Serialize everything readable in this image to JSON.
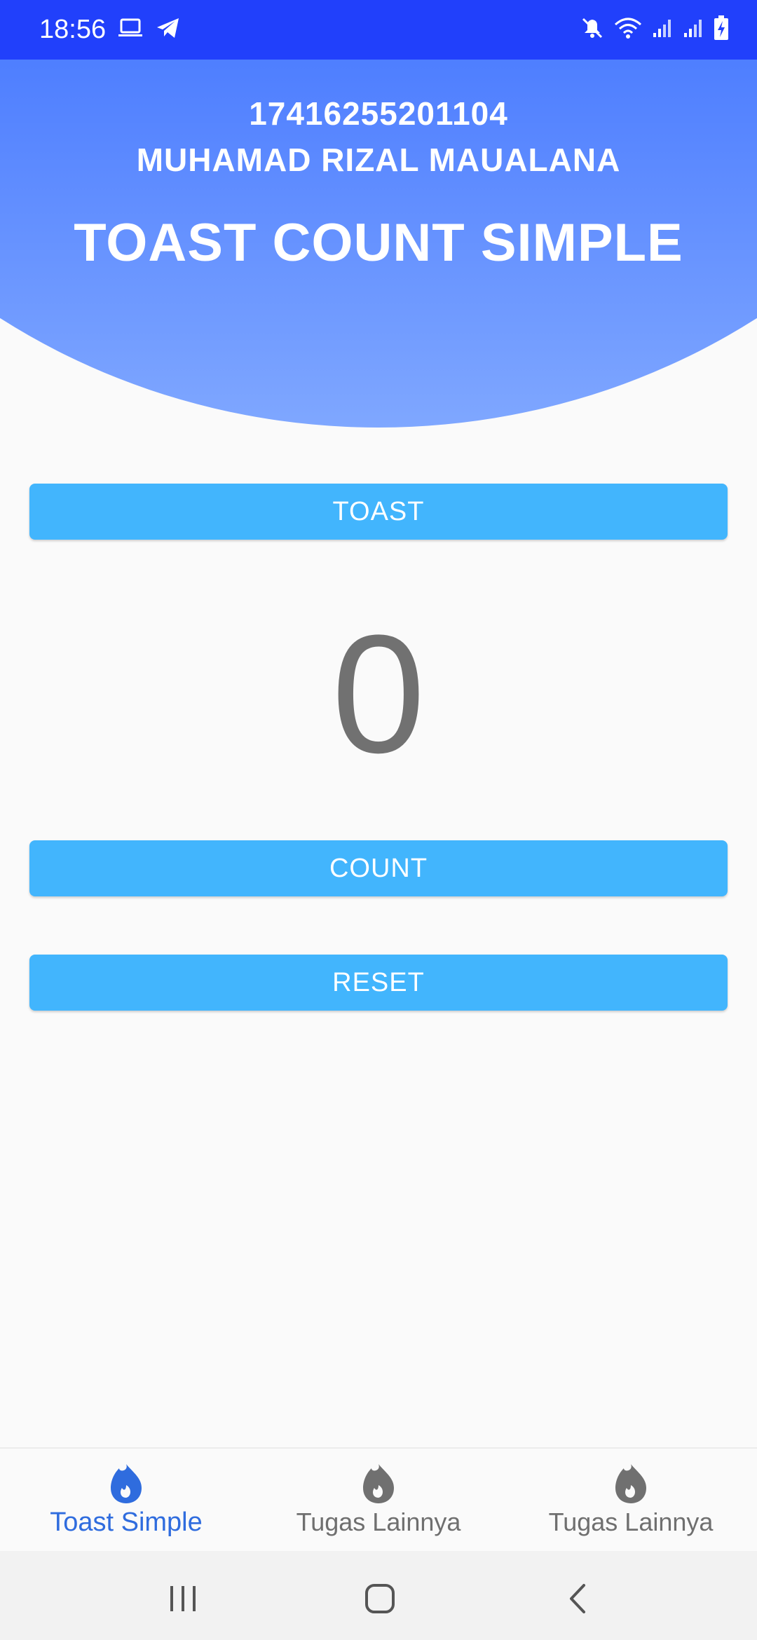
{
  "status_bar": {
    "time": "18:56",
    "left_icons": [
      "laptop-icon",
      "telegram-icon"
    ],
    "right_icons": [
      "mute-icon",
      "wifi-icon",
      "signal-icon",
      "signal-icon",
      "battery-charging-icon"
    ]
  },
  "header": {
    "student_id": "17416255201104",
    "student_name": "MUHAMAD RIZAL MAUALANA",
    "title": "TOAST COUNT SIMPLE"
  },
  "main": {
    "toast_button_label": "TOAST",
    "count_value": "0",
    "count_button_label": "COUNT",
    "reset_button_label": "RESET"
  },
  "bottom_nav": {
    "items": [
      {
        "label": "Toast Simple",
        "icon": "flame-icon",
        "active": true
      },
      {
        "label": "Tugas Lainnya",
        "icon": "flame-icon",
        "active": false
      },
      {
        "label": "Tugas Lainnya",
        "icon": "flame-icon",
        "active": false
      }
    ]
  },
  "system_nav": [
    "recents-button",
    "home-button",
    "back-button"
  ],
  "colors": {
    "status_bar": "#2140fb",
    "header_gradient_top": "#2f68ff",
    "header_gradient_bottom": "#7fa7ff",
    "button": "#42b5fd",
    "counter_text": "#717171",
    "nav_active": "#2f6cde",
    "nav_inactive": "#6f6f6f"
  }
}
